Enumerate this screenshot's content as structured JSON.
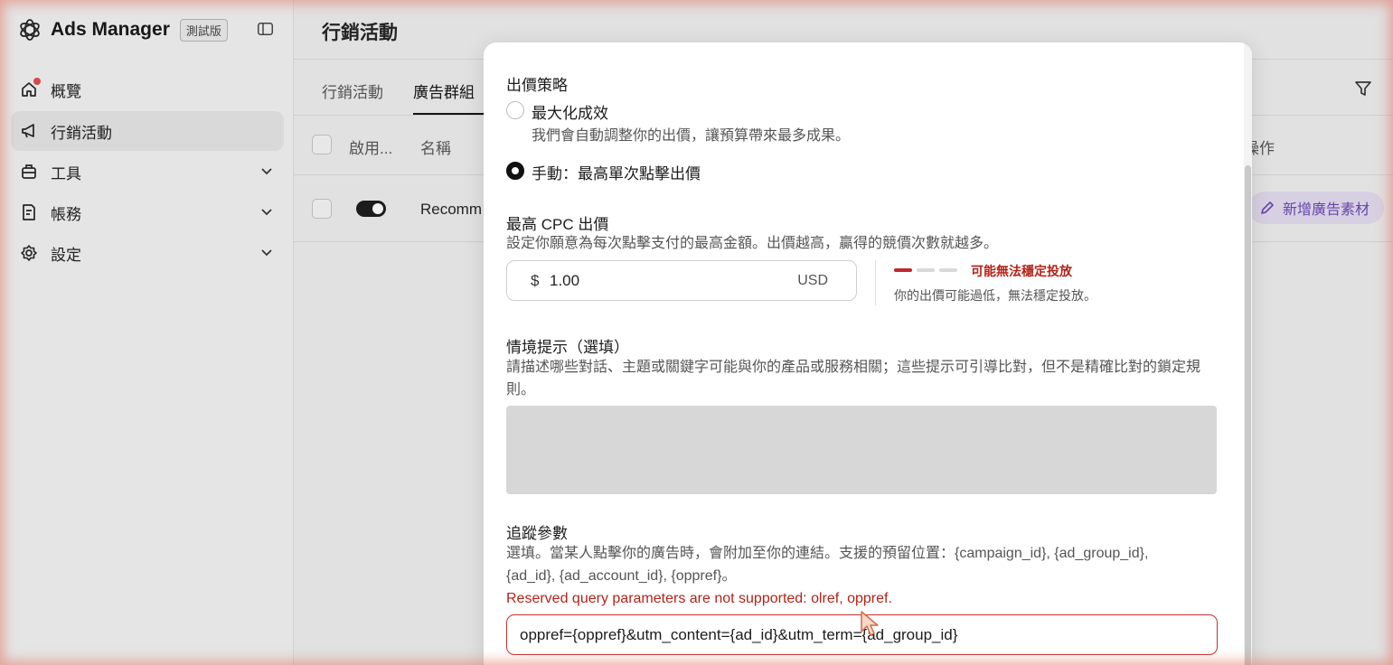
{
  "app": {
    "name": "Ads Manager",
    "beta_badge": "測試版"
  },
  "sidebar": {
    "items": [
      {
        "label": "概覽",
        "icon": "home-icon",
        "has_notification": true
      },
      {
        "label": "行銷活動",
        "icon": "megaphone-icon",
        "active": true
      },
      {
        "label": "工具",
        "icon": "toolbox-icon",
        "expandable": true
      },
      {
        "label": "帳務",
        "icon": "billing-icon",
        "expandable": true
      },
      {
        "label": "設定",
        "icon": "gear-icon",
        "expandable": true
      }
    ]
  },
  "main": {
    "title": "行銷活動",
    "tabs": [
      {
        "label": "行銷活動"
      },
      {
        "label": "廣告群組",
        "active": true
      }
    ],
    "table": {
      "headers": {
        "enabled": "啟用...",
        "name": "名稱",
        "actions": "操作"
      },
      "rows": [
        {
          "enabled": true,
          "name": "Recomm",
          "action_label": "新增廣告素材"
        }
      ]
    }
  },
  "modal": {
    "bid_strategy": {
      "title": "出價策略",
      "options": [
        {
          "label": "最大化成效",
          "description": "我們會自動調整你的出價，讓預算帶來最多成果。",
          "selected": false
        },
        {
          "label": "手動：最高單次點擊出價",
          "selected": true
        }
      ]
    },
    "max_cpc": {
      "title": "最高 CPC 出價",
      "description": "設定你願意為每次點擊支付的最高金額。出價越高，贏得的競價次數就越多。",
      "currency_symbol": "$",
      "value": "1.00",
      "currency": "USD",
      "strength_level": 1,
      "strength_max": 3,
      "warning_title": "可能無法穩定投放",
      "warning_description": "你的出價可能過低，無法穩定投放。"
    },
    "context_hints": {
      "title": "情境提示（選填）",
      "description": "請描述哪些對話、主題或關鍵字可能與你的產品或服務相關；這些提示可引導比對，但不是精確比對的鎖定規則。"
    },
    "tracking": {
      "title": "追蹤參數",
      "description_line1": "選填。當某人點擊你的廣告時，會附加至你的連結。支援的預留位置：{campaign_id}, {ad_group_id},",
      "description_line2": "{ad_id}, {ad_account_id}, {oppref}。",
      "error": "Reserved query parameters are not supported: olref, oppref.",
      "value": "oppref={oppref}&utm_content={ad_id}&utm_term={ad_group_id}"
    }
  },
  "colors": {
    "accent_purple": "#6b45b5",
    "error_red": "#b42318",
    "selected_black": "#111111"
  }
}
